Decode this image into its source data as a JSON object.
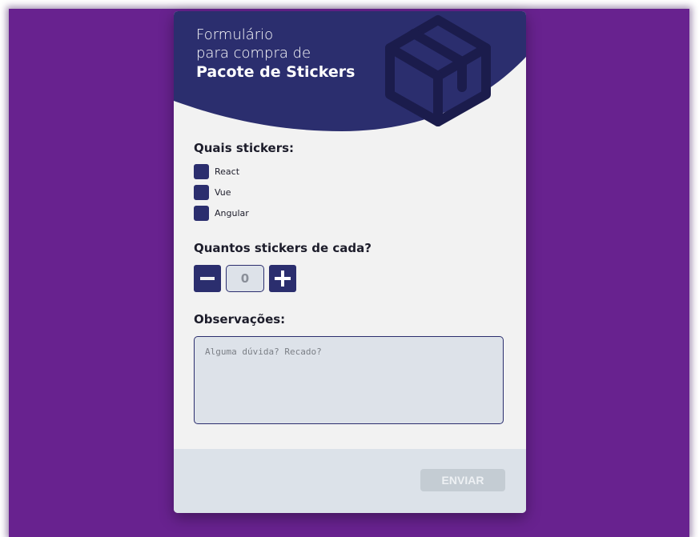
{
  "colors": {
    "backdrop": "#68228f",
    "header": "#2b2e6e",
    "accent": "#2b2e6e",
    "card": "#f2f2f2",
    "footer": "#dce2e9",
    "submit_disabled": "#c4ccd3"
  },
  "header": {
    "line1": "Formulário",
    "line2": "para compra de",
    "line3": "Pacote de Stickers",
    "illustration": "box-icon"
  },
  "stickers": {
    "label": "Quais stickers:",
    "options": [
      {
        "label": "React",
        "checked": false
      },
      {
        "label": "Vue",
        "checked": false
      },
      {
        "label": "Angular",
        "checked": false
      }
    ]
  },
  "quantity": {
    "label": "Quantos stickers de cada?",
    "value": "0",
    "decrement_icon": "minus-icon",
    "increment_icon": "plus-icon"
  },
  "notes": {
    "label": "Observações:",
    "placeholder": "Alguma dúvida? Recado?",
    "value": ""
  },
  "footer": {
    "submit_label": "ENVIAR",
    "submit_enabled": false
  }
}
